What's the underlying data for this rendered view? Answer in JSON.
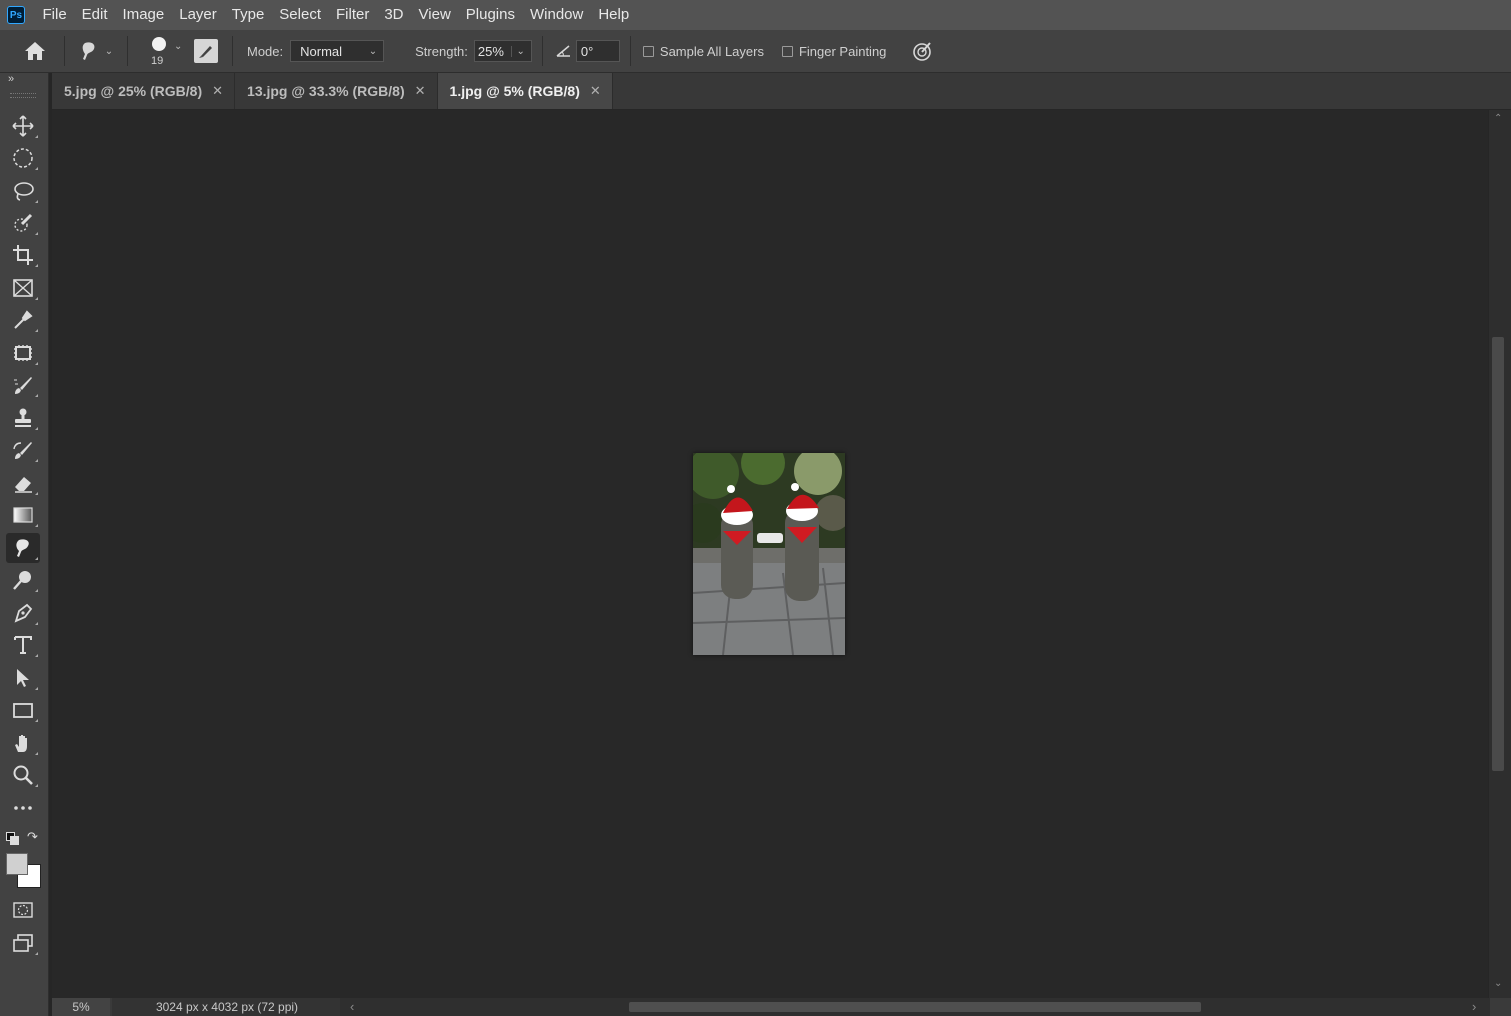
{
  "app": {
    "logo": "Ps"
  },
  "menu": [
    "File",
    "Edit",
    "Image",
    "Layer",
    "Type",
    "Select",
    "Filter",
    "3D",
    "View",
    "Plugins",
    "Window",
    "Help"
  ],
  "options": {
    "brush_size": "19",
    "mode_label": "Mode:",
    "mode_value": "Normal",
    "strength_label": "Strength:",
    "strength_value": "25%",
    "angle_value": "0°",
    "sample_all_layers_label": "Sample All Layers",
    "finger_painting_label": "Finger Painting",
    "sample_all_layers_checked": false,
    "finger_painting_checked": false
  },
  "tabs": [
    {
      "label": "5.jpg @ 25% (RGB/8)",
      "active": false
    },
    {
      "label": "13.jpg @ 33.3% (RGB/8)",
      "active": false
    },
    {
      "label": "1.jpg @ 5% (RGB/8)",
      "active": true
    }
  ],
  "toolbar_icons": [
    "move-icon",
    "elliptical-marquee-icon",
    "lasso-icon",
    "quick-selection-icon",
    "crop-icon",
    "frame-icon",
    "eyedropper-icon",
    "patch-icon",
    "brush-icon",
    "clone-stamp-icon",
    "history-brush-icon",
    "eraser-icon",
    "gradient-icon",
    "smudge-icon",
    "dodge-icon",
    "pen-icon",
    "type-icon",
    "path-selection-icon",
    "rectangle-icon",
    "hand-icon",
    "zoom-icon",
    "more-tools-icon"
  ],
  "selected_tool": "smudge-icon",
  "colors": {
    "foreground": "#d0d0d0",
    "background": "#ffffff"
  },
  "status": {
    "zoom": "5%",
    "doc_info": "3024 px x 4032 px (72 ppi)"
  },
  "scrollbar_arrows": {
    "right": "〉",
    "left": "‹",
    "right_end": "›"
  }
}
